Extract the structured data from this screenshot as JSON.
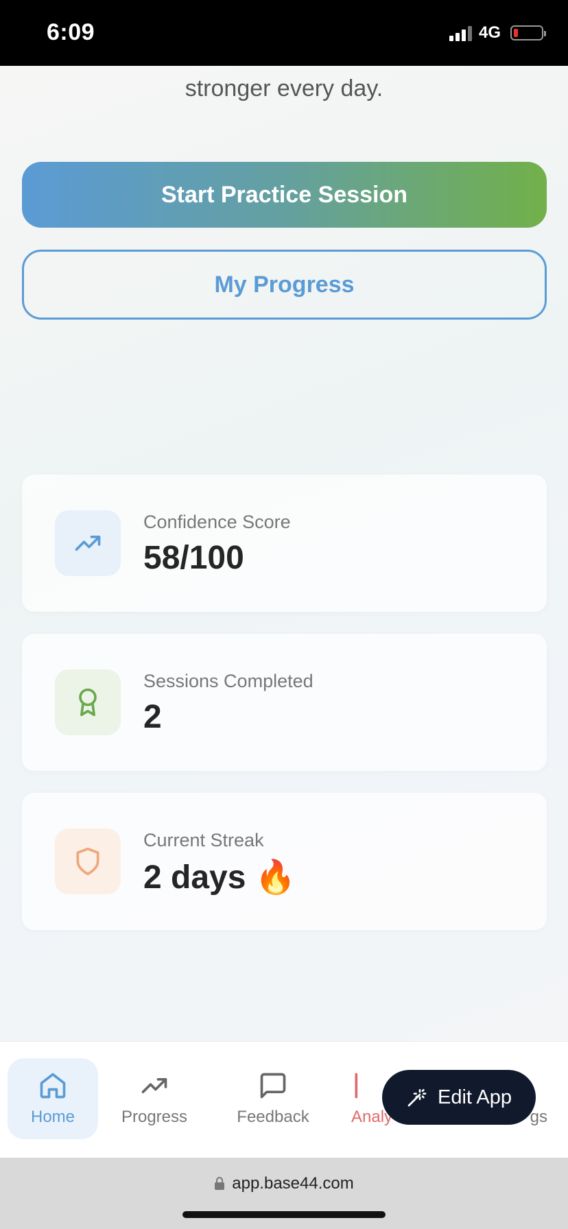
{
  "status_bar": {
    "time": "6:09",
    "network": "4G"
  },
  "hero": {
    "tagline": "stronger every day."
  },
  "buttons": {
    "primary": "Start Practice Session",
    "secondary": "My Progress"
  },
  "stats": [
    {
      "label": "Confidence Score",
      "value": "58/100",
      "icon": "trending-up-icon",
      "color": "#5b9bd5"
    },
    {
      "label": "Sessions Completed",
      "value": "2",
      "icon": "award-icon",
      "color": "#6aa84f"
    },
    {
      "label": "Current Streak",
      "value": "2 days 🔥",
      "icon": "shield-icon",
      "color": "#eea77a"
    }
  ],
  "bottom_nav": {
    "items": [
      {
        "label": "Home",
        "icon": "home-icon",
        "active": true
      },
      {
        "label": "Progress",
        "icon": "trending-up-icon"
      },
      {
        "label": "Feedback",
        "icon": "message-square-icon"
      },
      {
        "label": "Analy",
        "icon": "bar-icon"
      },
      {
        "label": "gs",
        "icon": "settings-icon"
      }
    ]
  },
  "edit_app": {
    "label": "Edit App",
    "icon": "magic-wand-icon"
  },
  "browser": {
    "url": "app.base44.com"
  },
  "colors": {
    "accent_blue": "#5b9bd5",
    "accent_green": "#72b04a",
    "dark_button": "#111a2c"
  }
}
